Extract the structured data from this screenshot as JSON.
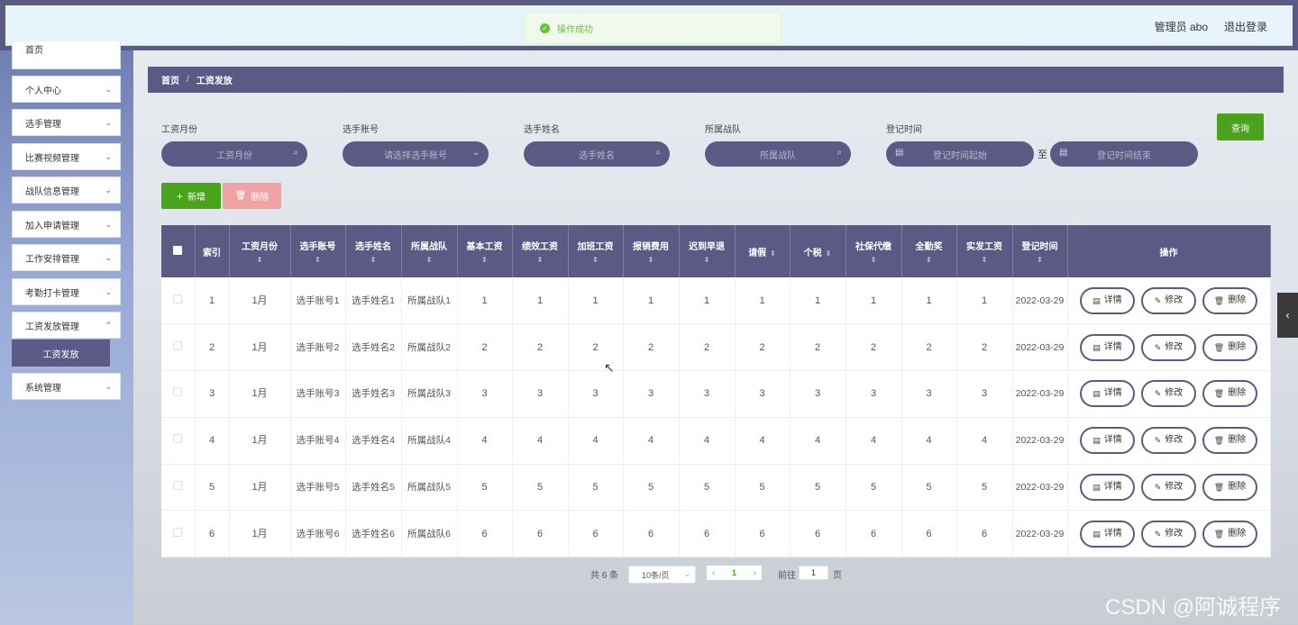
{
  "header": {
    "toast": "操作成功",
    "user": "管理员 abo",
    "logout": "退出登录"
  },
  "sidebar": {
    "items": [
      {
        "label": "首页"
      },
      {
        "label": "个人中心"
      },
      {
        "label": "选手管理"
      },
      {
        "label": "比赛视频管理"
      },
      {
        "label": "战队信息管理"
      },
      {
        "label": "加入申请管理"
      },
      {
        "label": "工作安排管理"
      },
      {
        "label": "考勤打卡管理"
      },
      {
        "label": "工资发放管理"
      },
      {
        "label": "工资发放"
      },
      {
        "label": "系统管理"
      }
    ]
  },
  "breadcrumb": {
    "home": "首页",
    "sep": "/",
    "current": "工资发放"
  },
  "filters": {
    "month": {
      "label": "工资月份",
      "placeholder": "工资月份"
    },
    "account": {
      "label": "选手账号",
      "placeholder": "请选择选手账号"
    },
    "name": {
      "label": "选手姓名",
      "placeholder": "选手姓名"
    },
    "team": {
      "label": "所属战队",
      "placeholder": "所属战队"
    },
    "time": {
      "label": "登记时间",
      "start_placeholder": "登记时间起始",
      "end_placeholder": "登记时间结束",
      "separator": "至"
    },
    "query_button": "查询"
  },
  "actions": {
    "add": "新增",
    "delete": "删除"
  },
  "table": {
    "headers": [
      "索引",
      "工资月份",
      "选手账号",
      "选手姓名",
      "所属战队",
      "基本工资",
      "绩效工资",
      "加班工资",
      "报销费用",
      "迟到早退",
      "请假",
      "个税",
      "社保代缴",
      "全勤奖",
      "实发工资",
      "登记时间",
      "操作"
    ],
    "row_actions": {
      "detail": "详情",
      "edit": "修改",
      "delete": "删除"
    },
    "rows": [
      {
        "idx": "1",
        "month": "1月",
        "account": "选手账号1",
        "name": "选手姓名1",
        "team": "所属战队1",
        "base": "1",
        "perf": "1",
        "overtime": "1",
        "reimb": "1",
        "late": "1",
        "leave": "1",
        "tax": "1",
        "social": "1",
        "attend": "1",
        "actual": "1",
        "time": "2022-03-29"
      },
      {
        "idx": "2",
        "month": "1月",
        "account": "选手账号2",
        "name": "选手姓名2",
        "team": "所属战队2",
        "base": "2",
        "perf": "2",
        "overtime": "2",
        "reimb": "2",
        "late": "2",
        "leave": "2",
        "tax": "2",
        "social": "2",
        "attend": "2",
        "actual": "2",
        "time": "2022-03-29"
      },
      {
        "idx": "3",
        "month": "1月",
        "account": "选手账号3",
        "name": "选手姓名3",
        "team": "所属战队3",
        "base": "3",
        "perf": "3",
        "overtime": "3",
        "reimb": "3",
        "late": "3",
        "leave": "3",
        "tax": "3",
        "social": "3",
        "attend": "3",
        "actual": "3",
        "time": "2022-03-29"
      },
      {
        "idx": "4",
        "month": "1月",
        "account": "选手账号4",
        "name": "选手姓名4",
        "team": "所属战队4",
        "base": "4",
        "perf": "4",
        "overtime": "4",
        "reimb": "4",
        "late": "4",
        "leave": "4",
        "tax": "4",
        "social": "4",
        "attend": "4",
        "actual": "4",
        "time": "2022-03-29"
      },
      {
        "idx": "5",
        "month": "1月",
        "account": "选手账号5",
        "name": "选手姓名5",
        "team": "所属战队5",
        "base": "5",
        "perf": "5",
        "overtime": "5",
        "reimb": "5",
        "late": "5",
        "leave": "5",
        "tax": "5",
        "social": "5",
        "attend": "5",
        "actual": "5",
        "time": "2022-03-29"
      },
      {
        "idx": "6",
        "month": "1月",
        "account": "选手账号6",
        "name": "选手姓名6",
        "team": "所属战队6",
        "base": "6",
        "perf": "6",
        "overtime": "6",
        "reimb": "6",
        "late": "6",
        "leave": "6",
        "tax": "6",
        "social": "6",
        "attend": "6",
        "actual": "6",
        "time": "2022-03-29"
      }
    ]
  },
  "pagination": {
    "total": "共 6 条",
    "page_size": "10条/页",
    "current": "1",
    "goto_prefix": "前往",
    "goto_value": "1",
    "goto_suffix": "页"
  },
  "watermark": "CSDN @阿诚程序",
  "colors": {
    "primary": "#5b5a84",
    "success": "#4aa31a",
    "danger_light": "#f0a3a3"
  }
}
